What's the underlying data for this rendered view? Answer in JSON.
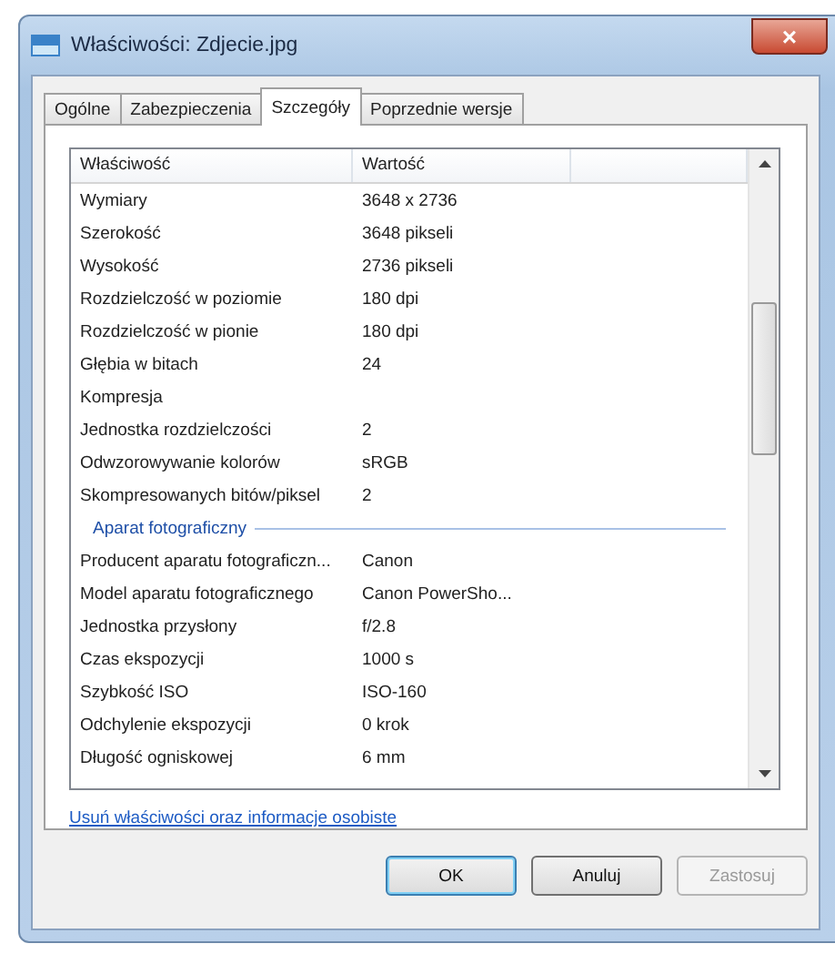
{
  "window": {
    "title": "Właściwości: Zdjecie.jpg",
    "close": "×"
  },
  "tabs": [
    {
      "label": "Ogólne",
      "selected": false
    },
    {
      "label": "Zabezpieczenia",
      "selected": false
    },
    {
      "label": "Szczegóły",
      "selected": true
    },
    {
      "label": "Poprzednie wersje",
      "selected": false
    }
  ],
  "table": {
    "columns": [
      "Właściwość",
      "Wartość"
    ],
    "rows": [
      {
        "kind": "property",
        "name": "Wymiary",
        "value": "3648 x 2736"
      },
      {
        "kind": "property",
        "name": "Szerokość",
        "value": "3648 pikseli"
      },
      {
        "kind": "property",
        "name": "Wysokość",
        "value": "2736 pikseli"
      },
      {
        "kind": "property",
        "name": "Rozdzielczość w poziomie",
        "value": "180 dpi"
      },
      {
        "kind": "property",
        "name": "Rozdzielczość w pionie",
        "value": "180 dpi"
      },
      {
        "kind": "property",
        "name": "Głębia w bitach",
        "value": "24"
      },
      {
        "kind": "property",
        "name": "Kompresja"
      },
      {
        "kind": "property",
        "name": "Jednostka rozdzielczości",
        "value": "2"
      },
      {
        "kind": "property",
        "name": "Odwzorowywanie kolorów",
        "value": "sRGB"
      },
      {
        "kind": "property",
        "name": "Skompresowanych bitów/piksel",
        "value": "2"
      },
      {
        "kind": "group",
        "name": "Aparat fotograficzny"
      },
      {
        "kind": "property",
        "name": "Producent aparatu fotograficzn...",
        "value": "Canon"
      },
      {
        "kind": "property",
        "name": "Model aparatu fotograficznego",
        "value": "Canon PowerSho..."
      },
      {
        "kind": "property",
        "name": "Jednostka przysłony",
        "value": "f/2.8"
      },
      {
        "kind": "property",
        "name": "Czas ekspozycji",
        "value": "1000 s"
      },
      {
        "kind": "property",
        "name": "Szybkość ISO",
        "value": "ISO-160"
      },
      {
        "kind": "property",
        "name": "Odchylenie ekspozycji",
        "value": "0 krok"
      },
      {
        "kind": "property",
        "name": "Długość ogniskowej",
        "value": "6 mm"
      }
    ]
  },
  "link": "Usuń właściwości oraz informacje osobiste",
  "buttons": [
    {
      "label": "OK",
      "default": true,
      "disabled": false
    },
    {
      "label": "Anuluj",
      "default": false,
      "disabled": false
    },
    {
      "label": "Zastosuj",
      "default": false,
      "disabled": true
    }
  ]
}
